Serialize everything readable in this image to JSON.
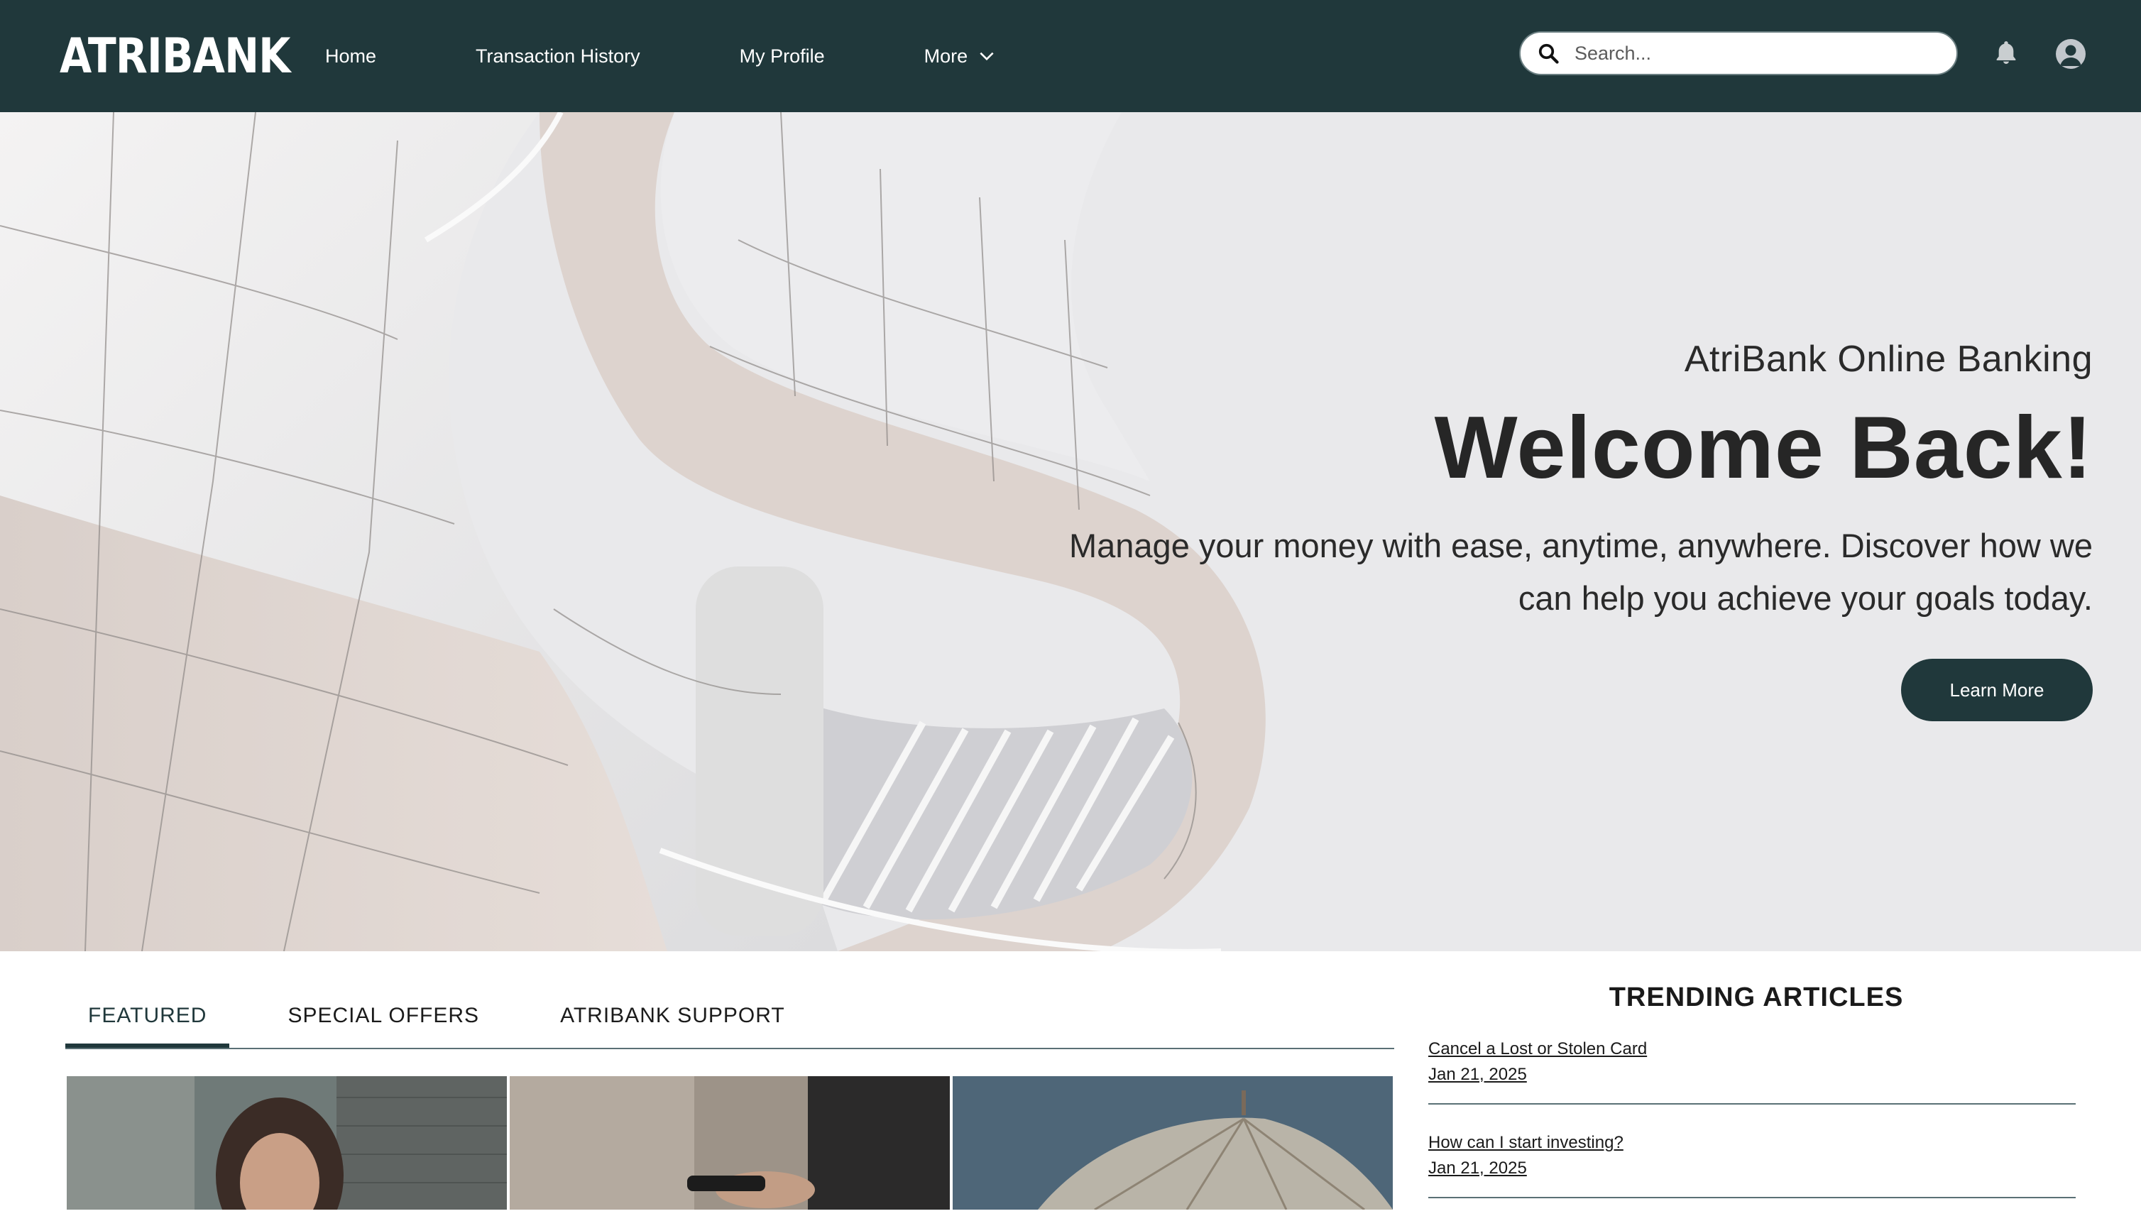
{
  "brand": {
    "logo_text": "ATRIBANK",
    "accent_color": "#20383b"
  },
  "nav": {
    "items": [
      {
        "label": "Home"
      },
      {
        "label": "Transaction History"
      },
      {
        "label": "My Profile"
      },
      {
        "label": "More",
        "icon": "chevron-down-icon"
      }
    ]
  },
  "search": {
    "placeholder": "Search...",
    "icon": "search-icon"
  },
  "header_icons": {
    "notifications": "bell-icon",
    "user": "avatar-icon"
  },
  "hero": {
    "subtitle": "AtriBank Online Banking",
    "title": "Welcome Back!",
    "description": "Manage your money with ease, anytime, anywhere. Discover how we can help you achieve your goals today.",
    "cta_label": "Learn More"
  },
  "tabs": {
    "items": [
      {
        "label": "FEATURED",
        "active": true
      },
      {
        "label": "SPECIAL OFFERS",
        "active": false
      },
      {
        "label": "ATRIBANK SUPPORT",
        "active": false
      }
    ]
  },
  "trending": {
    "heading": "TRENDING ARTICLES",
    "articles": [
      {
        "title": "Cancel a Lost or Stolen Card",
        "date": "Jan 21, 2025"
      },
      {
        "title": "How can I start investing?",
        "date": "Jan 21, 2025"
      }
    ]
  }
}
